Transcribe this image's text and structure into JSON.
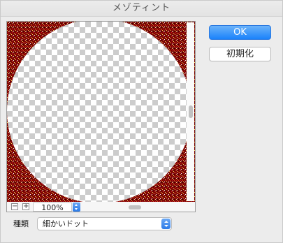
{
  "window": {
    "title": "メゾティント"
  },
  "preview": {
    "zoom_value": "100%",
    "zoom_out_glyph": "−",
    "zoom_in_glyph": "+"
  },
  "buttons": {
    "ok_label": "OK",
    "reset_label": "初期化"
  },
  "type": {
    "label": "種類",
    "selected": "細かいドット"
  },
  "colors": {
    "accent": "#1a82fb",
    "noise_dark": "#6b0000",
    "noise_red": "#c41212",
    "noise_yellow": "#f6d55a"
  },
  "icons": [
    "zoom-out-icon",
    "zoom-in-icon",
    "stepper-icon",
    "popup-arrows-icon"
  ]
}
